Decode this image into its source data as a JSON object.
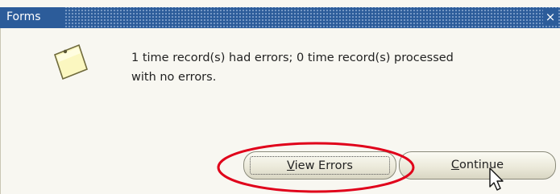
{
  "window": {
    "title": "Forms",
    "close_glyph": "×"
  },
  "message": {
    "line1": "1 time record(s) had errors; 0 time record(s) processed",
    "line2": "with no errors."
  },
  "buttons": {
    "view_errors": {
      "mnemonic": "V",
      "rest": "iew Errors"
    },
    "continue": {
      "mnemonic": "C",
      "rest": "ontinue"
    }
  },
  "icons": {
    "note": "note-icon",
    "close": "close-icon",
    "cursor": "mouse-pointer-icon"
  },
  "colors": {
    "titlebar": "#2c5c9a",
    "annotation": "#e0001a",
    "note_fill": "#fbf7c0"
  }
}
